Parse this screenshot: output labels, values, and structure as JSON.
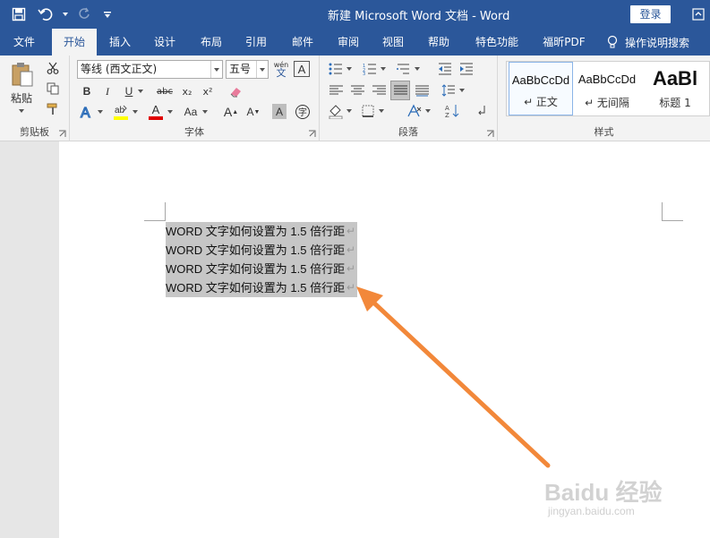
{
  "window": {
    "title": "新建 Microsoft Word 文档  -  Word",
    "login": "登录"
  },
  "tabs": [
    {
      "label": "文件"
    },
    {
      "label": "开始"
    },
    {
      "label": "插入"
    },
    {
      "label": "设计"
    },
    {
      "label": "布局"
    },
    {
      "label": "引用"
    },
    {
      "label": "邮件"
    },
    {
      "label": "审阅"
    },
    {
      "label": "视图"
    },
    {
      "label": "帮助"
    },
    {
      "label": "特色功能"
    },
    {
      "label": "福昕PDF"
    }
  ],
  "tell_me": "操作说明搜索",
  "ribbon": {
    "clipboard": {
      "label": "剪贴板",
      "paste": "粘贴"
    },
    "font": {
      "label": "字体",
      "font_name": "等线 (西文正文)",
      "font_size": "五号",
      "bold": "B",
      "italic": "I",
      "underline": "U",
      "strike": "abc",
      "subscript": "x₂",
      "superscript": "x²",
      "change_case": "Aa",
      "grow": "A",
      "shrink": "A",
      "phonetic": "wén",
      "phonetic_char": "文"
    },
    "paragraph": {
      "label": "段落"
    },
    "styles": {
      "label": "样式",
      "items": [
        {
          "preview": "AaBbCcDd",
          "name": "↵ 正文"
        },
        {
          "preview": "AaBbCcDd",
          "name": "↵ 无间隔"
        },
        {
          "preview": "AaBl",
          "name": "标题 1"
        }
      ]
    }
  },
  "document": {
    "lines": [
      "WORD 文字如何设置为 1.5 倍行距",
      "WORD 文字如何设置为 1.5 倍行距",
      "WORD 文字如何设置为 1.5 倍行距",
      "WORD 文字如何设置为 1.5 倍行距"
    ],
    "paragraph_mark": "↵"
  },
  "watermark": {
    "brand": "Baidu 经验",
    "url": "jingyan.baidu.com"
  },
  "colors": {
    "accent": "#2b579a",
    "highlight": "#ffff00",
    "font_color": "#e00000",
    "annotation_arrow": "#f2883a"
  }
}
